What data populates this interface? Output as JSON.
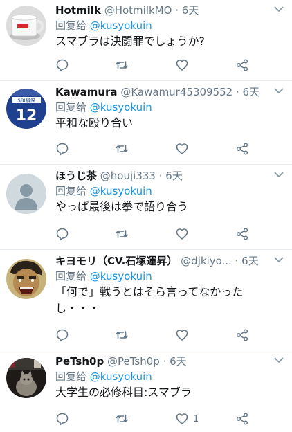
{
  "tweets": [
    {
      "name": "Hotmilk",
      "handle": "@HotmilkMO",
      "separator": "·",
      "time": "6天",
      "reply_prefix": "回复给",
      "reply_to": "@kusyokuin",
      "text": "スマブラは決闘罪でしょうか?",
      "like_count": "",
      "avatar": "mug-icon"
    },
    {
      "name": "Kawamura",
      "handle": "@Kawamur45309552",
      "separator": "·",
      "time": "6天",
      "reply_prefix": "回复给",
      "reply_to": "@kusyokuin",
      "text": "平和な殴り合い",
      "like_count": "",
      "avatar": "jersey-icon",
      "avatar_jersey_text": "12",
      "avatar_jersey_sponsor": "SBI損保"
    },
    {
      "name": "ほうじ茶",
      "handle": "@houji333",
      "separator": "·",
      "time": "6天",
      "reply_prefix": "回复给",
      "reply_to": "@kusyokuin",
      "text": "やっぱ最後は拳で語り合う",
      "like_count": "",
      "avatar": "default-user-icon"
    },
    {
      "name": "キヨモリ（CV.石塚運昇）",
      "handle": "@djkiyo...",
      "separator": "·",
      "time": "6天",
      "reply_prefix": "回复给",
      "reply_to": "@kusyokuin",
      "text": "「何で」戦うとはそら言ってなかったし・・・",
      "like_count": "",
      "avatar": "anime-face-icon"
    },
    {
      "name": "PeTsh0p",
      "handle": "@PeTsh0p",
      "separator": "·",
      "time": "6天",
      "reply_prefix": "回复给",
      "reply_to": "@kusyokuin",
      "text": "大学生の必修科目:スマブラ",
      "like_count": "1",
      "avatar": "cat-photo-icon"
    }
  ],
  "colors": {
    "name": "#14171a",
    "muted": "#657786",
    "link": "#1b95e0",
    "divider": "#e6ecf0"
  }
}
